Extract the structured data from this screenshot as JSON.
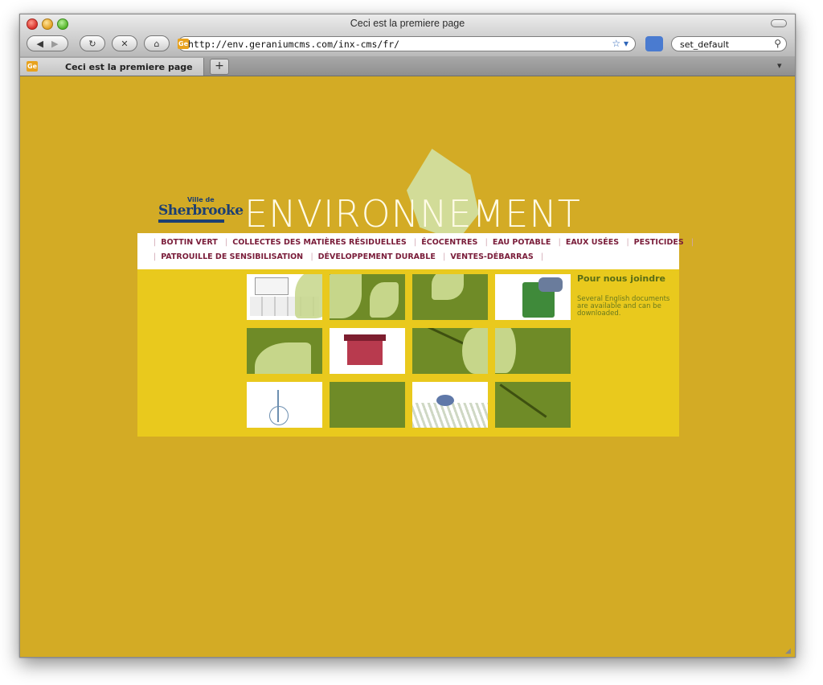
{
  "window": {
    "title": "Ceci est la premiere page"
  },
  "toolbar": {
    "url": "http://env.geraniumcms.com/inx-cms/fr/",
    "favicon_text": "Ge",
    "search_value": "set_default",
    "back_icon": "back-arrow-icon",
    "forward_icon": "forward-arrow-icon",
    "reload_icon": "reload-icon",
    "stop_icon": "stop-icon",
    "home_icon": "home-icon",
    "bookmark_icon": "star-icon"
  },
  "tabs": [
    {
      "label": "Ceci est la premiere page"
    }
  ],
  "site": {
    "logo_text": "Sherbrooke",
    "logo_ville": "Ville de",
    "headline": "ENVIRONNEMENT",
    "nav_row1": [
      "BOTTIN VERT",
      "COLLECTES DES MATIÈRES RÉSIDUELLES",
      "ÉCOCENTRES",
      "EAU POTABLE",
      "EAUX USÉES",
      "PESTICIDES"
    ],
    "nav_row2": [
      "PATROUILLE DE SENSIBILISATION",
      "DÉVELOPPEMENT DURABLE",
      "VENTES-DÉBARRAS"
    ],
    "sidebar": {
      "title": "Pour nous joindre",
      "text": "Several English documents are available and can be downloaded."
    }
  },
  "colors": {
    "page_bg": "#d3ab25",
    "panel_bg": "#e9c91d",
    "tile_green": "#6f8b27",
    "leaf_light": "#c6d68a",
    "nav_text": "#7a1d3a"
  }
}
